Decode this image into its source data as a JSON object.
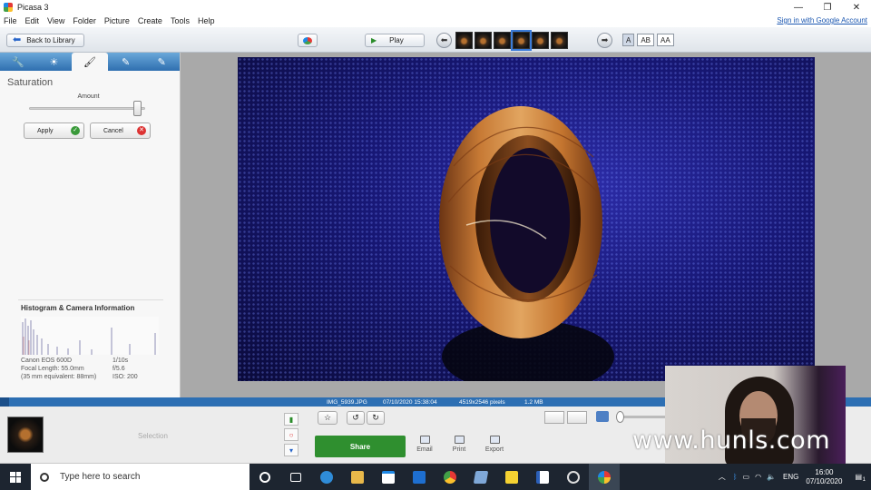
{
  "window": {
    "title": "Picasa 3",
    "controls": [
      "—",
      "❐",
      "✕"
    ]
  },
  "menu": [
    "File",
    "Edit",
    "View",
    "Folder",
    "Picture",
    "Create",
    "Tools",
    "Help"
  ],
  "signin_link": "Sign in with Google Account",
  "toolbar": {
    "back_label": "Back to Library",
    "play_label": "Play",
    "caption_modes": [
      "A",
      "AB",
      "AA"
    ]
  },
  "left_panel": {
    "tabs": [
      "wrench-icon",
      "sun-icon",
      "brush-icon",
      "pencil-green-icon",
      "pencil-blue-icon"
    ],
    "effect_title": "Saturation",
    "amount_label": "Amount",
    "amount_value": 0.97,
    "apply_label": "Apply",
    "cancel_label": "Cancel",
    "histogram_title": "Histogram & Camera Information",
    "camera_left": [
      "Canon EOS 600D",
      "Focal Length: 55.0mm",
      "(35 mm equivalent: 88mm)"
    ],
    "camera_right": [
      "1/10s",
      "f/5.6",
      "ISO: 200"
    ]
  },
  "info_bar": {
    "filename": "IMG_5939.JPG",
    "datetime": "07/10/2020 15:38:04",
    "dimensions": "4519x2546 pixels",
    "filesize": "1.2 MB"
  },
  "tray": {
    "selection_label": "Selection",
    "share_label": "Share",
    "actions": [
      "Email",
      "Print",
      "Export"
    ]
  },
  "watermark": "www.hunls.com",
  "taskbar": {
    "search_placeholder": "Type here to search",
    "language": "ENG",
    "time": "16:00",
    "date": "07/10/2020",
    "notification_count": "1"
  }
}
